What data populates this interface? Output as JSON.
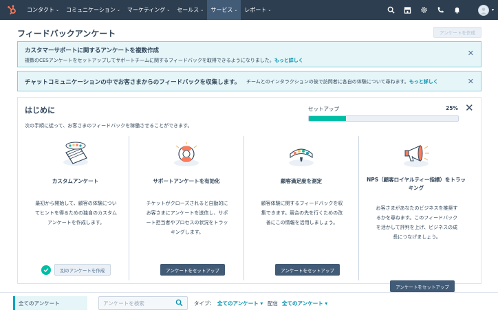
{
  "nav": {
    "items": [
      {
        "label": "コンタクト",
        "active": false
      },
      {
        "label": "コミュニケーション",
        "active": false
      },
      {
        "label": "マーケティング",
        "active": false
      },
      {
        "label": "セールス",
        "active": false
      },
      {
        "label": "サービス",
        "active": true
      },
      {
        "label": "レポート",
        "active": false
      }
    ],
    "right_icons": [
      "search-icon",
      "marketplace-icon",
      "settings-icon",
      "calling-icon",
      "notifications-icon"
    ],
    "brand_color": "#2d3e50",
    "active_color": "#425b76"
  },
  "page": {
    "title": "フィードバックアンケート",
    "create_button": "アンケートを作成"
  },
  "banners": [
    {
      "title": "カスタマーサポートに関するアンケートを複数作成",
      "body": "複数のCESアンケートをセットアップしてサポートチームに関するフィードバックを取得できるようになりました。",
      "link": "もっと詳しく"
    },
    {
      "title": "チャットコミュニケーションの中でお客さまからのフィードバックを収集します。",
      "body": "チームとのインタラクションの後で訪問者に各自の体験について尋ねます。",
      "link": "もっと詳しく"
    }
  ],
  "getting_started": {
    "title": "はじめに",
    "subtitle": "次の手順に従って、お客さまのフィードバックを稼働させることができます。",
    "progress_label": "セットアップ",
    "progress_percent_text": "25%",
    "progress_value": 0.25,
    "accent_color": "#00bda5",
    "steps": [
      {
        "title": "カスタムアンケート",
        "body": "最初から開始して、顧客の体験についてヒントを得るための独自のカスタムアンケートを作成します。",
        "button": "別のアンケートを作成",
        "completed": true
      },
      {
        "title": "サポートアンケートを有効化",
        "body": "チケットがクローズされると自動的にお客さまにアンケートを送信し、サポート担当者やプロセスの状況をトラッキングします。",
        "button": "アンケートをセットアップ",
        "completed": false
      },
      {
        "title": "顧客満足度を測定",
        "body": "顧客体験に関するフィードバックを収集できます。競合の先を行くための改善にこの情報を活用しましょう。",
        "button": "アンケートをセットアップ",
        "completed": false
      },
      {
        "title": "NPS（顧客ロイヤルティー指標）をトラッキング",
        "body": "お客さまがあなたのビジネスを推奨するかを尋ねます。このフィードバックを活かして評判を上げ、ビジネスの成長につなげましょう。",
        "button": "アンケートをセットアップ",
        "completed": false
      }
    ]
  },
  "filters": {
    "all_surveys": "全てのアンケート",
    "search_placeholder": "アンケートを検索",
    "type_label": "タイプ：",
    "type_value": "全てのアンケート",
    "delivery_label": "配信",
    "delivery_value": "全てのアンケート"
  }
}
